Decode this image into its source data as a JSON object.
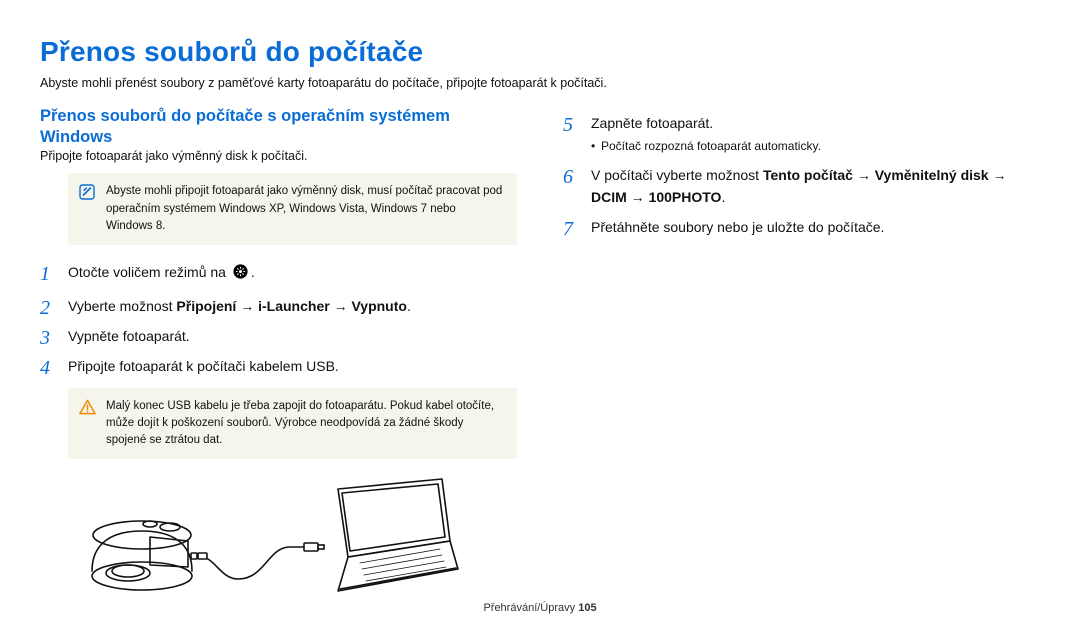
{
  "title": "Přenos souborů do počítače",
  "intro": "Abyste mohli přenést soubory z paměťové karty fotoaparátu do počítače, připojte fotoaparát k počítači.",
  "left": {
    "subheading": "Přenos souborů do počítače s operačním systémem Windows",
    "subintro": "Připojte fotoaparát jako výměnný disk k počítači.",
    "note": "Abyste mohli připojit fotoaparát jako výměnný disk, musí počítač pracovat pod operačním systémem Windows XP, Windows Vista, Windows 7 nebo Windows 8.",
    "step1_pre": "Otočte voličem režimů na ",
    "step1_post": ".",
    "step2_pre": "Vyberte možnost ",
    "step2_b1": "Připojení",
    "step2_arrow1": " → ",
    "step2_b2": "i-Launcher",
    "step2_arrow2": " → ",
    "step2_b3": "Vypnuto",
    "step2_post": ".",
    "step3": "Vypněte fotoaparát.",
    "step4": "Připojte fotoaparát k počítači kabelem USB.",
    "warn": "Malý konec USB kabelu je třeba zapojit do fotoaparátu. Pokud kabel otočíte, může dojít k poškození souborů. Výrobce neodpovídá za žádné škody spojené se ztrátou dat."
  },
  "right": {
    "step5": "Zapněte fotoaparát.",
    "step5_sub": "Počítač rozpozná fotoaparát automaticky.",
    "step6_pre": "V počítači vyberte možnost ",
    "step6_b1": "Tento počítač",
    "step6_a1": " → ",
    "step6_b2": "Vyměnitelný disk",
    "step6_a2": " → ",
    "step6_b3": "DCIM",
    "step6_a3": " → ",
    "step6_b4": "100PHOTO",
    "step6_post": ".",
    "step7": "Přetáhněte soubory nebo je uložte do počítače."
  },
  "footer_label": "Přehrávání/Úpravy  ",
  "footer_page": "105",
  "nums": {
    "n1": "1",
    "n2": "2",
    "n3": "3",
    "n4": "4",
    "n5": "5",
    "n6": "6",
    "n7": "7"
  }
}
